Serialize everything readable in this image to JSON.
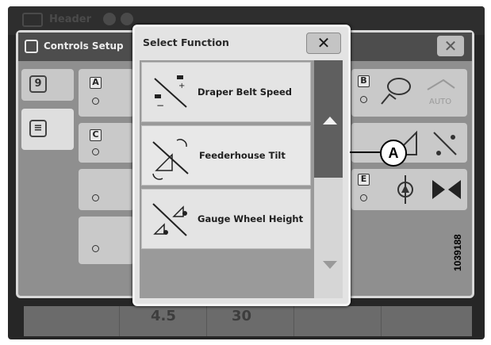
{
  "header": {
    "title": "Header"
  },
  "bottom_values": [
    "4.5",
    "30"
  ],
  "controls_setup": {
    "title": "Controls Setup",
    "close_glyph": "✕",
    "left_tab_glyphs": [
      "9",
      "≡"
    ],
    "column_letters": [
      "A",
      "C",
      "B",
      "E"
    ],
    "auto_label": "AUTO"
  },
  "select_function": {
    "title": "Select Function",
    "close_glyph": "✕",
    "items": [
      {
        "label": "Draper Belt Speed",
        "icon": "draper-belt-speed-icon"
      },
      {
        "label": "Feederhouse Tilt",
        "icon": "feederhouse-tilt-icon"
      },
      {
        "label": "Gauge Wheel Height",
        "icon": "gauge-wheel-height-icon"
      }
    ],
    "scroll_up_icon": "triangle-up-icon",
    "scroll_down_icon": "triangle-down-icon"
  },
  "callout": {
    "letter": "A"
  },
  "figure_id": "1039188"
}
